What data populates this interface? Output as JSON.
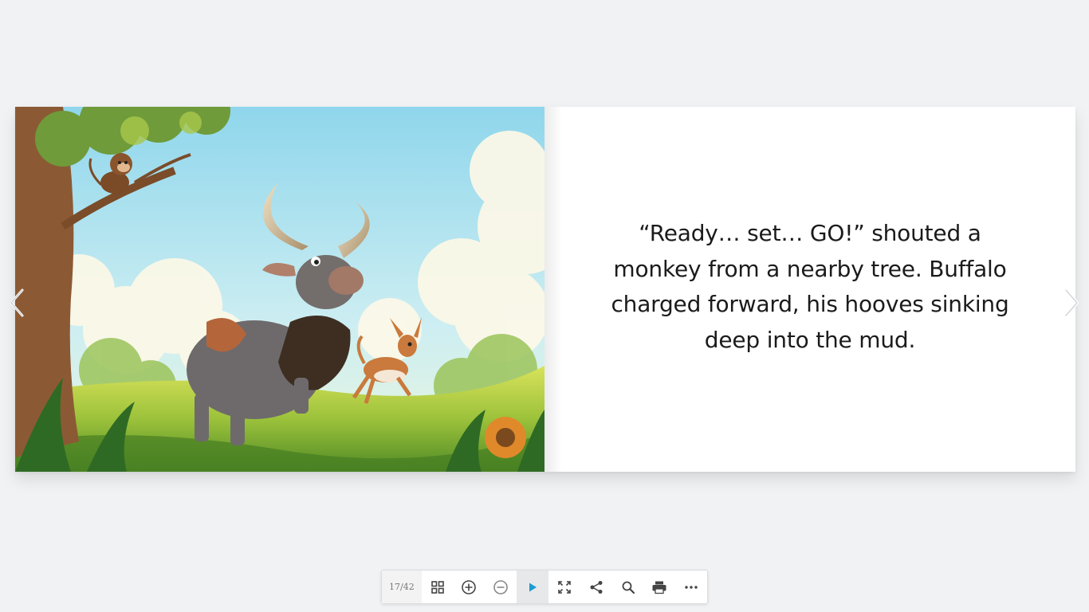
{
  "book": {
    "story_text": "“Ready… set… GO!” shouted a monkey from a nearby tree. Buffalo charged forward, his hooves sinking deep into the mud."
  },
  "navigation": {
    "prev_icon": "chevron-left-icon",
    "next_icon": "chevron-right-icon"
  },
  "toolbar": {
    "page_counter": "17/42",
    "buttons": [
      {
        "icon": "grid-icon"
      },
      {
        "icon": "zoom-in-icon"
      },
      {
        "icon": "zoom-out-icon"
      },
      {
        "icon": "play-icon"
      },
      {
        "icon": "fullscreen-icon"
      },
      {
        "icon": "share-icon"
      },
      {
        "icon": "search-icon"
      },
      {
        "icon": "print-icon"
      },
      {
        "icon": "more-icon"
      }
    ]
  },
  "colors": {
    "background": "#f1f2f4",
    "play_accent": "#1a9dd1",
    "icon": "#444444"
  }
}
